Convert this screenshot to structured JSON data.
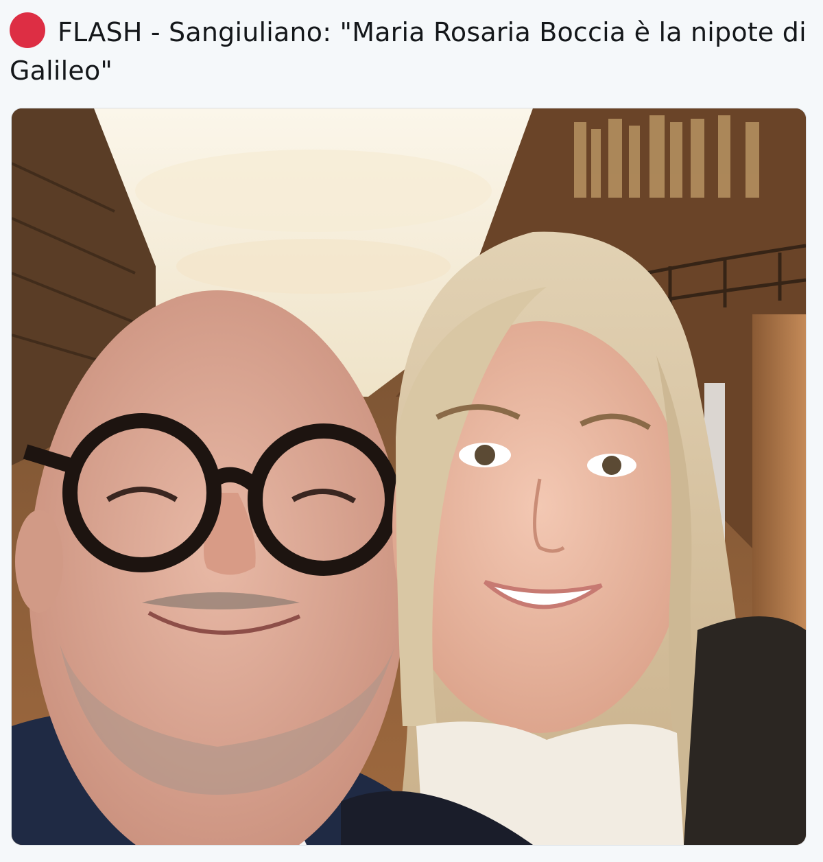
{
  "tweet": {
    "emoji_icon": "red-circle-icon",
    "text": "FLASH - Sangiuliano: \"Maria Rosaria Boccia è la nipote di Galileo\""
  },
  "media": {
    "type": "photo",
    "colors": {
      "page_background": "#f5f8fa",
      "text": "#14171a",
      "emoji_red": "#dd2e44"
    }
  }
}
